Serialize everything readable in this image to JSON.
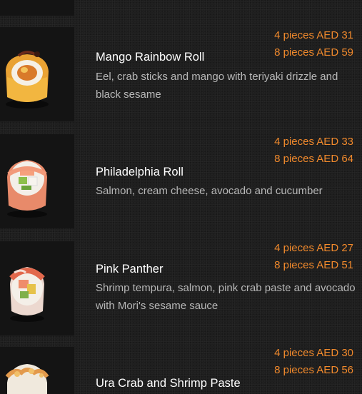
{
  "menu": {
    "items": [
      {
        "name": "Mango Rainbow Roll",
        "description": "Eel, crab sticks and mango with teriyaki drizzle and black sesame",
        "price_4": "4 pieces AED 31",
        "price_8": "8 pieces AED 59"
      },
      {
        "name": "Philadelphia Roll",
        "description": "Salmon, cream cheese, avocado and cucumber",
        "price_4": "4 pieces AED 33",
        "price_8": "8 pieces AED 64"
      },
      {
        "name": "Pink Panther",
        "description": "Shrimp tempura, salmon, pink crab paste and avocado with Mori's sesame sauce",
        "price_4": "4 pieces AED 27",
        "price_8": "8 pieces AED 51"
      },
      {
        "name": "Ura Crab and Shrimp Paste",
        "description": "",
        "price_4": "4 pieces AED 30",
        "price_8": "8 pieces AED 56"
      }
    ]
  },
  "colors": {
    "background": "#1e1e1e",
    "price": "#f0892c",
    "title": "#ffffff",
    "description": "#b8b8b8"
  }
}
